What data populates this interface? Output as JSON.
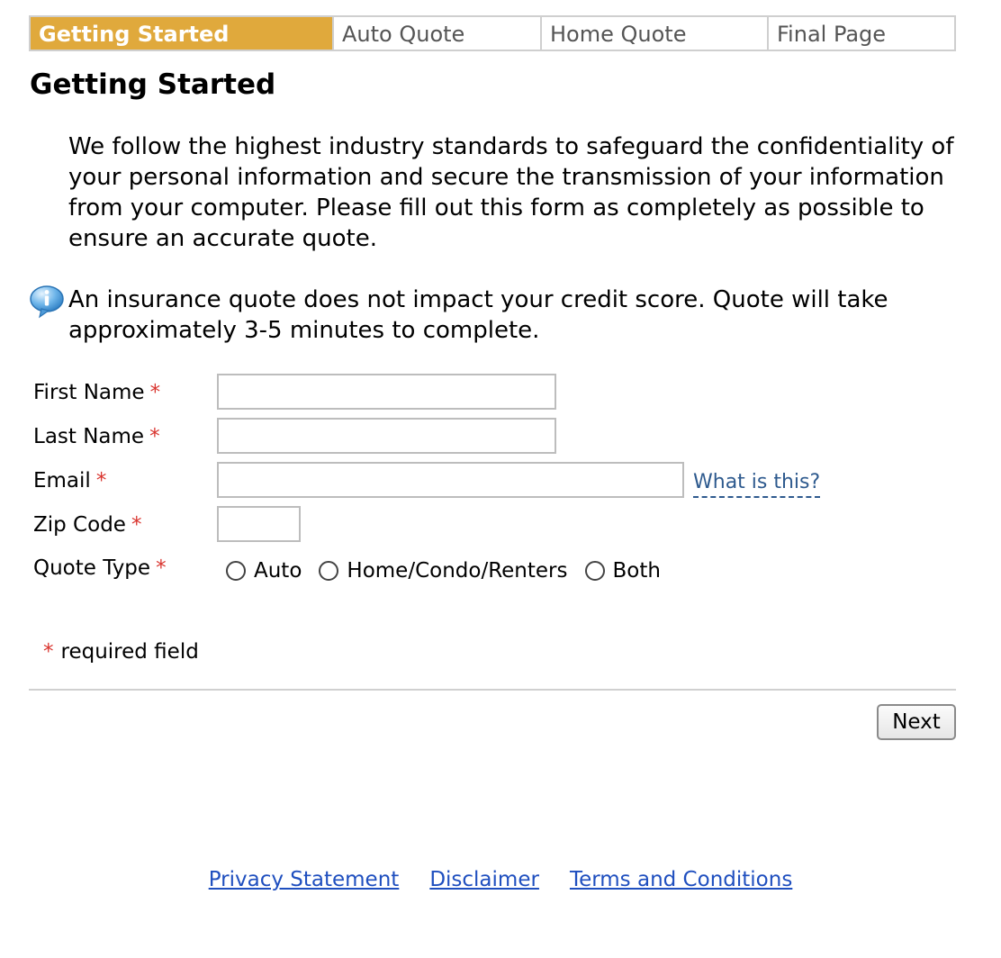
{
  "tabs": [
    {
      "label": "Getting Started",
      "active": true
    },
    {
      "label": "Auto Quote",
      "active": false
    },
    {
      "label": "Home Quote",
      "active": false
    },
    {
      "label": "Final Page",
      "active": false
    }
  ],
  "page_title": "Getting Started",
  "intro_text": "We follow the highest industry standards to safeguard the confidentiality of your personal information and secure the transmission of your information from your computer. Please fill out this form as completely as possible to ensure an accurate quote.",
  "notice": {
    "icon": "info-icon",
    "text": "An insurance quote does not impact your credit score. Quote will take approximately 3-5 minutes to complete."
  },
  "form": {
    "first_name": {
      "label": "First Name",
      "value": ""
    },
    "last_name": {
      "label": "Last Name",
      "value": ""
    },
    "email": {
      "label": "Email",
      "value": "",
      "help_link": "What is this?"
    },
    "zip_code": {
      "label": "Zip Code",
      "value": ""
    },
    "quote_type": {
      "label": "Quote Type",
      "options": [
        "Auto",
        "Home/Condo/Renters",
        "Both"
      ],
      "selected": null
    },
    "required_marker": "*",
    "required_note": "required field"
  },
  "next_label": "Next",
  "footer_links": [
    "Privacy Statement",
    "Disclaimer",
    "Terms and Conditions"
  ],
  "colors": {
    "active_tab": "#e0a93c",
    "required": "#d9352f",
    "help_link": "#2e5a8e",
    "footer_link": "#1f4fbf"
  }
}
